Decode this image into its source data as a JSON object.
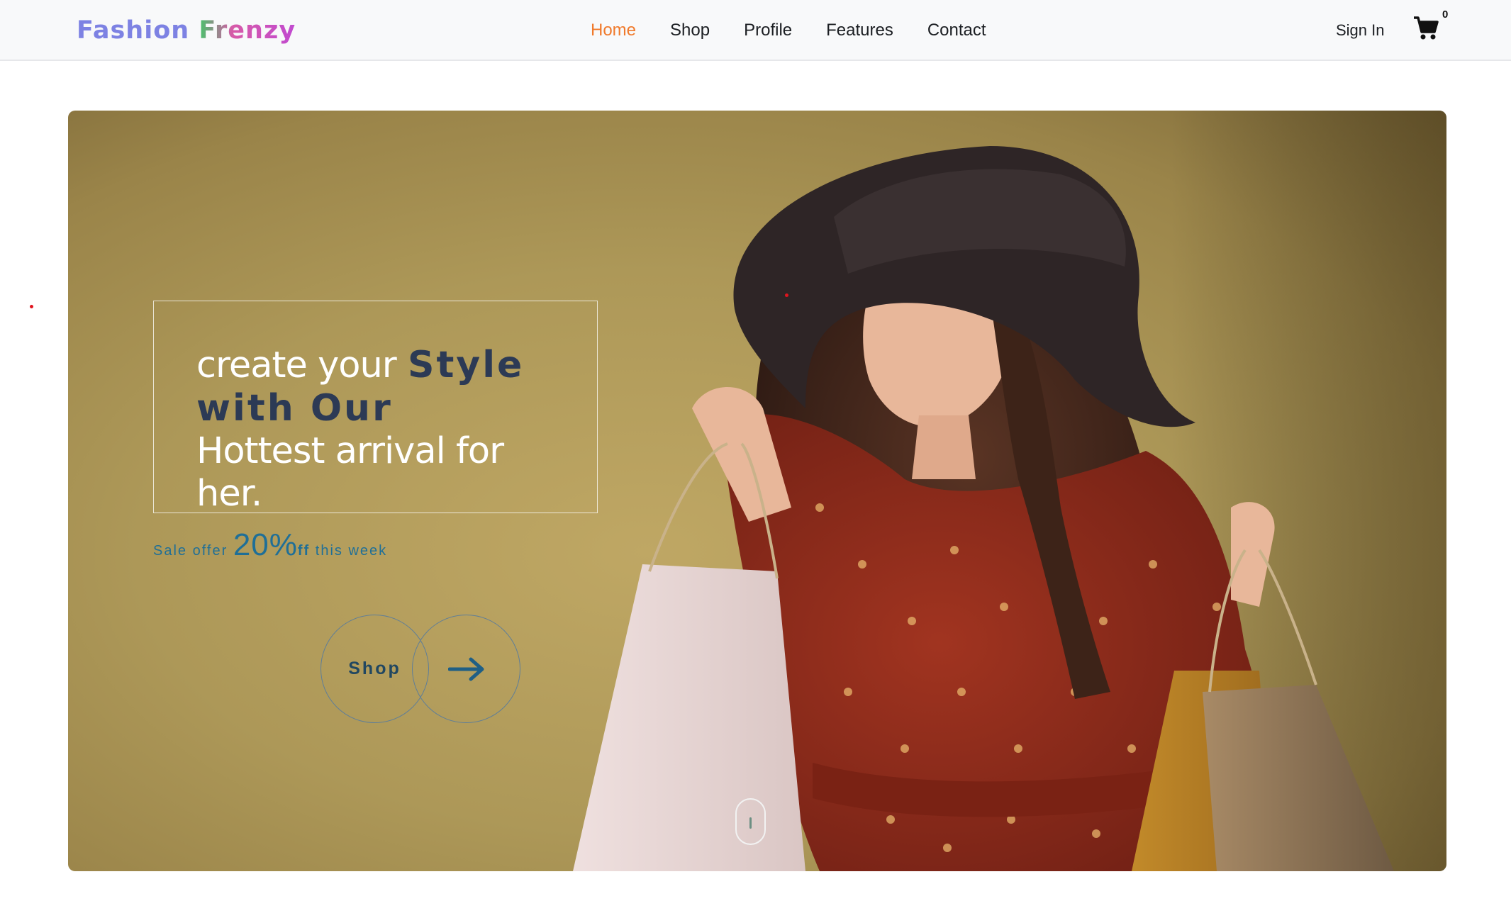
{
  "brand": {
    "word1": "Fashion",
    "word2": "Frenzy"
  },
  "nav": {
    "items": [
      {
        "label": "Home",
        "active": true
      },
      {
        "label": "Shop"
      },
      {
        "label": "Profile"
      },
      {
        "label": "Features"
      },
      {
        "label": "Contact"
      }
    ],
    "sign_in": "Sign In",
    "cart_icon": "shopping-cart-icon",
    "cart_count": "0",
    "active_color": "#f07a2b"
  },
  "hero": {
    "headline_line1": "create your",
    "headline_bold": "Style with Our",
    "headline_line3": "Hottest arrival for her.",
    "sale_prefix": "Sale offer",
    "sale_percent": "20%",
    "sale_ff": "ff",
    "sale_suffix": "this week",
    "shop_button": "Shop",
    "arrow_icon": "arrow-right-icon",
    "scroll_icon": "scroll-mouse-icon",
    "background_color": "#ad9858",
    "accent_color": "#1f6f97",
    "bold_color": "#2c3a55"
  }
}
